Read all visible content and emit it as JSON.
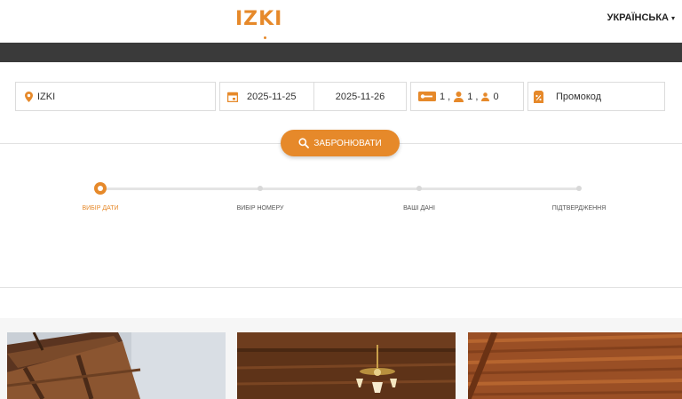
{
  "header": {
    "logo": "IZKI",
    "language": "УКРАЇНСЬКА"
  },
  "search": {
    "location": "IZKI",
    "checkin": "2025-11-25",
    "checkout": "2025-11-26",
    "rooms": "1 ,",
    "adults": "1 ,",
    "children": "0",
    "promo_placeholder": "Промокод"
  },
  "book_button": "ЗАБРОНЮВАТИ",
  "steps": [
    {
      "label": "ВИБІР ДАТИ",
      "active": true
    },
    {
      "label": "ВИБІР НОМЕРУ",
      "active": false
    },
    {
      "label": "ВАШІ ДАНІ",
      "active": false
    },
    {
      "label": "ПІДТВЕРДЖЕННЯ",
      "active": false
    }
  ],
  "colors": {
    "accent": "#e6892a",
    "dark_bar": "#3a3a3a"
  },
  "icons": [
    "map-pin-icon",
    "calendar-icon",
    "key-card-icon",
    "adult-icon",
    "child-icon",
    "discount-tag-icon",
    "search-icon",
    "chevron-down-icon"
  ]
}
